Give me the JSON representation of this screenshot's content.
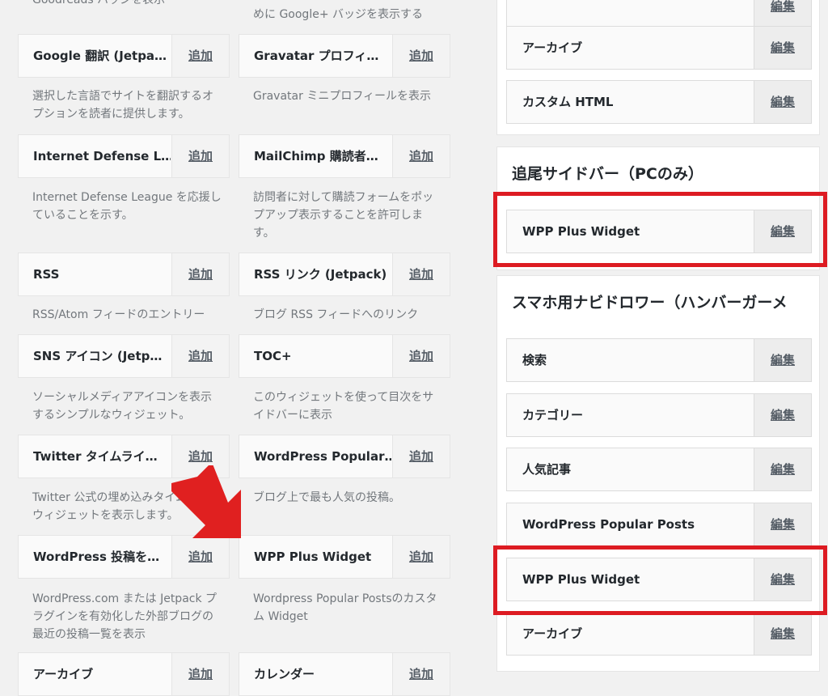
{
  "available_widgets": {
    "top_descriptions": [
      "Goodreads バッジを表示",
      "めに Google+ バッジを表示する"
    ],
    "widgets": [
      {
        "title": "Google 翻訳 (Jetpa…",
        "add": "追加",
        "desc": "選択した言語でサイトを翻訳するオプションを読者に提供します。"
      },
      {
        "title": "Gravatar プロフィ…",
        "add": "追加",
        "desc": "Gravatar ミニプロフィールを表示"
      },
      {
        "title": "Internet Defense L…",
        "add": "追加",
        "desc": "Internet Defense League を応援していることを示す。"
      },
      {
        "title": "MailChimp 購読者…",
        "add": "追加",
        "desc": "訪問者に対して購読フォームをポップアップ表示することを許可します。"
      },
      {
        "title": "RSS",
        "add": "追加",
        "desc": "RSS/Atom フィードのエントリー"
      },
      {
        "title": "RSS リンク (Jetpack)",
        "add": "追加",
        "desc": "ブログ RSS フィードへのリンク"
      },
      {
        "title": "SNS アイコン (Jetp…",
        "add": "追加",
        "desc": "ソーシャルメディアアイコンを表示するシンプルなウィジェット。"
      },
      {
        "title": "TOC+",
        "add": "追加",
        "desc": "このウィジェットを使って目次をサイドバーに表示"
      },
      {
        "title": "Twitter タイムライ…",
        "add": "追加",
        "desc": "Twitter 公式の埋め込みタイムラインウィジェットを表示します。"
      },
      {
        "title": "WordPress Popular…",
        "add": "追加",
        "desc": "ブログ上で最も人気の投稿。"
      },
      {
        "title": "WordPress 投稿を…",
        "add": "追加",
        "desc": "WordPress.com または Jetpack プラグインを有効化した外部ブログの最近の投稿一覧を表示"
      },
      {
        "title": "WPP Plus Widget",
        "add": "追加",
        "desc": "Wordpress Popular Postsのカスタム Widget"
      },
      {
        "title": "アーカイブ",
        "add": "追加",
        "desc": ""
      },
      {
        "title": "カレンダー",
        "add": "追加",
        "desc": ""
      }
    ]
  },
  "sidebars": {
    "top_panel": {
      "items": [
        {
          "title": "",
          "edit": "編集"
        },
        {
          "title": "アーカイブ",
          "edit": "編集"
        },
        {
          "title": "カスタム HTML",
          "edit": "編集"
        }
      ]
    },
    "follow_panel": {
      "title": "追尾サイドバー（PCのみ）",
      "items": [
        {
          "title": "WPP Plus Widget",
          "edit": "編集"
        }
      ]
    },
    "drawer_panel": {
      "title": "スマホ用ナビドロワー（ハンバーガーメ",
      "items": [
        {
          "title": "検索",
          "edit": "編集"
        },
        {
          "title": "カテゴリー",
          "edit": "編集"
        },
        {
          "title": "人気記事",
          "edit": "編集"
        },
        {
          "title": "WordPress Popular Posts",
          "edit": "編集"
        },
        {
          "title": "WPP Plus Widget",
          "edit": "編集"
        },
        {
          "title": "アーカイブ",
          "edit": "編集"
        }
      ]
    }
  },
  "colors": {
    "highlight": "#dd1b22",
    "arrow": "#e02020"
  }
}
